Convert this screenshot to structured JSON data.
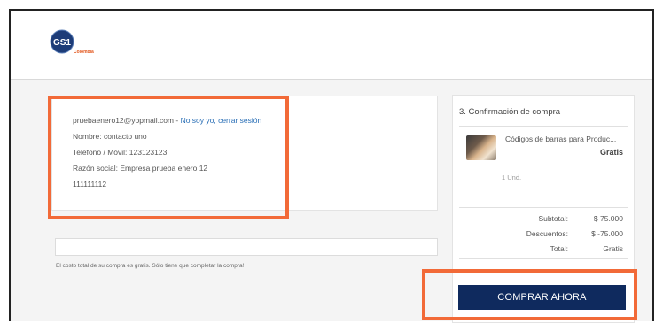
{
  "header": {
    "logo": {
      "mark": "GS1",
      "subtext": "Colombia"
    }
  },
  "customer": {
    "email": "pruebaenero12@yopmail.com",
    "separator": " - ",
    "logout_link": "No soy yo, cerrar sesión",
    "name_line": "Nombre: contacto uno",
    "phone_line": "Teléfono / Móvil: 123123123",
    "company_line": "Razón social: Empresa prueba enero 12",
    "id_line": "111111112"
  },
  "note": "El costo total de su compra es gratis. Sólo tiene que completar la compra!",
  "summary": {
    "title": "3. Confirmación de compra",
    "product": {
      "name": "Códigos de barras para Produc...",
      "price": "Gratis",
      "qty": "1 Und."
    },
    "subtotal_label": "Subtotal:",
    "subtotal_value": "$ 75.000",
    "discount_label": "Descuentos:",
    "discount_value": "$ -75.000",
    "total_label": "Total:",
    "total_value": "Gratis"
  },
  "buy_button": "COMPRAR AHORA",
  "colors": {
    "accent_highlight": "#f26a38",
    "button": "#0f2a5e",
    "link": "#2a6fb6"
  }
}
